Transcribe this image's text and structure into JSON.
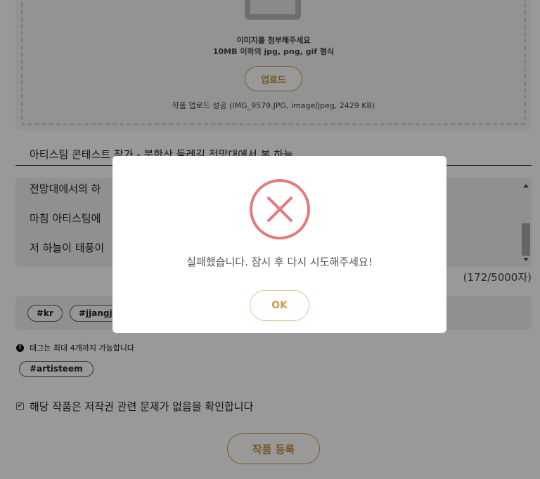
{
  "upload": {
    "icon": "image-placeholder-icon",
    "hint_line1": "이미지를 첨부해주세요",
    "hint_line2": "10MB 이하의 jpg, png, gif 형식",
    "button_label": "업로드",
    "status": "작품 업로드 성공 (IMG_9579.JPG, image/jpeg, 2429 KB)"
  },
  "title": {
    "value": "아티스팀 콘테스트 참가 - 북한산 둘레길 전망대에서 본 하늘"
  },
  "content": {
    "lines": [
      "전망대에서의 하",
      "마침 아티스팀에",
      "저 하늘이 태풍이"
    ],
    "char_count": "(172/5000자)"
  },
  "tags": {
    "chips": [
      "#kr",
      "#jjangjja"
    ],
    "notice": "태그는 최대 4개까지 가능합니다",
    "selected": [
      "#artisteem"
    ]
  },
  "confirm": {
    "label": "해당 작품은 저작권 관련 문제가 없음을 확인합니다",
    "checked": true
  },
  "submit": {
    "label": "작품 등록"
  },
  "modal": {
    "icon": "error-x-icon",
    "message": "실패했습니다. 잠시 후 다시 시도해주세요!",
    "ok_label": "OK",
    "accent": "#e27b7b"
  }
}
